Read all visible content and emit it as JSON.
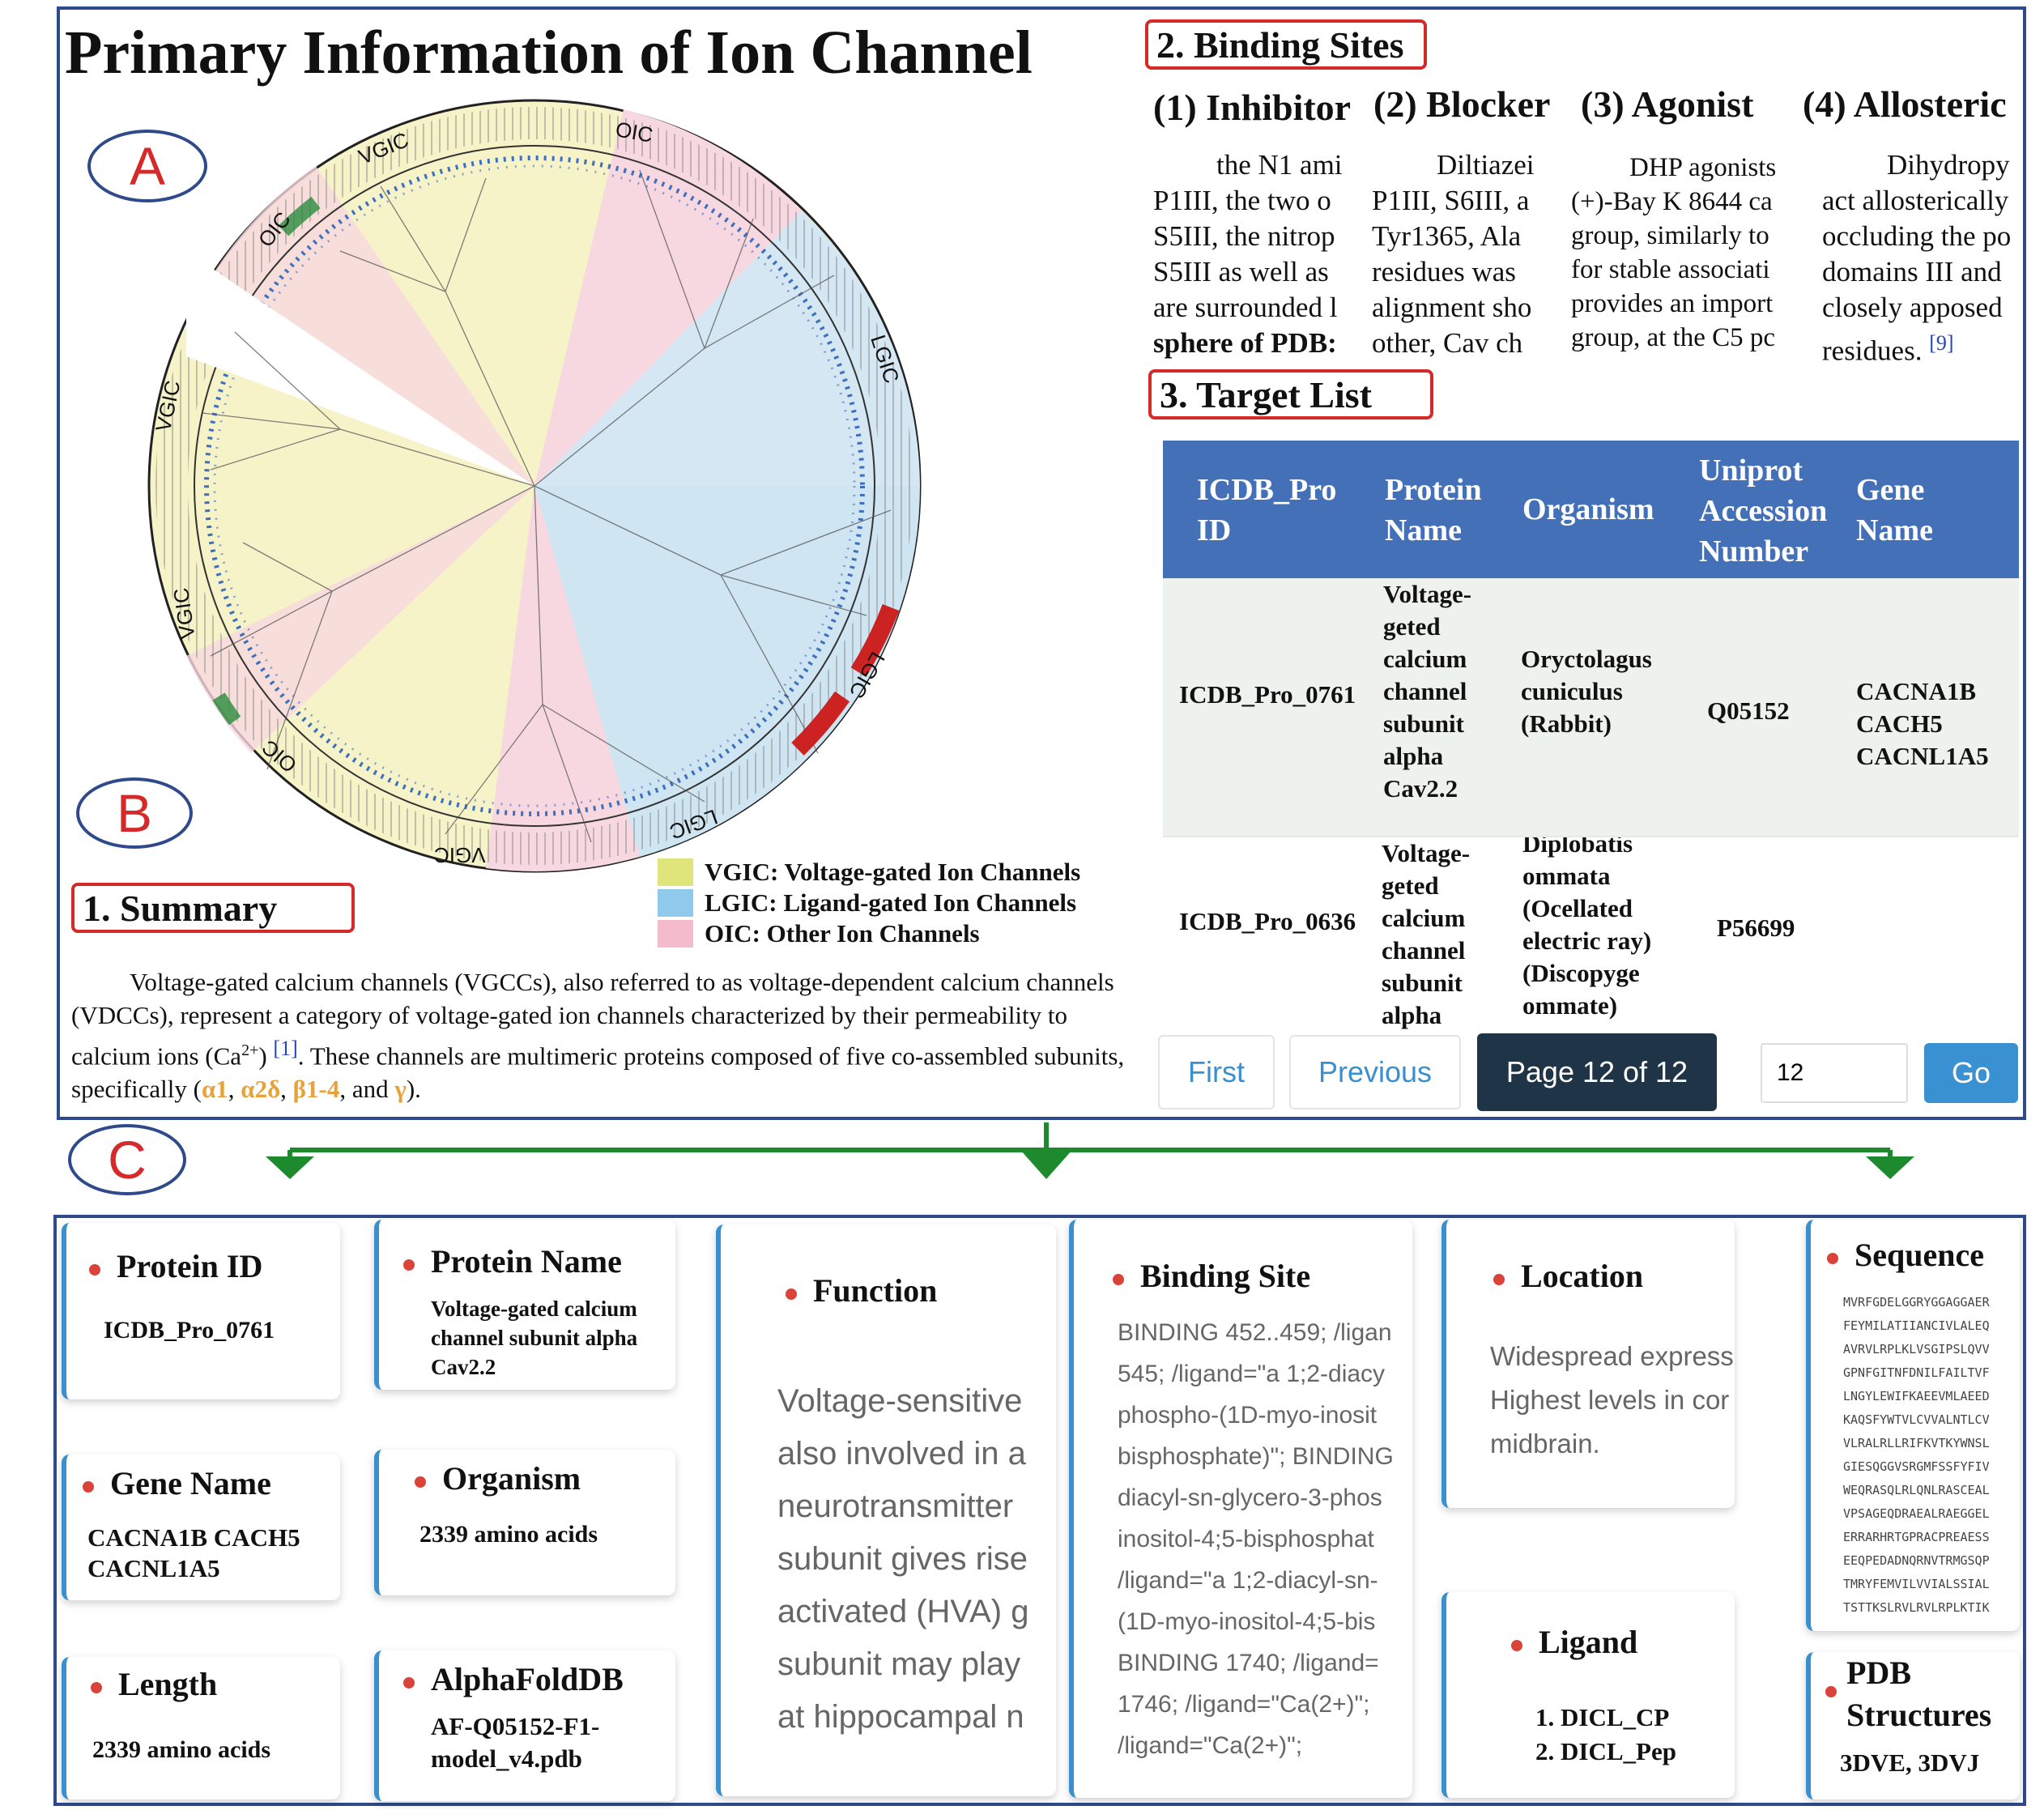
{
  "title": "Primary Information of Ion Channel",
  "labels": {
    "a": "A",
    "b": "B",
    "c": "C"
  },
  "tree": {
    "ring_labels": [
      "VGIC",
      "OIC",
      "OIC",
      "LGIC",
      "VGIC",
      "VGIC",
      "OIC",
      "LGIC",
      "LGIC",
      "VGIC"
    ],
    "colors": {
      "vgic": "#f4f0c2",
      "lgic": "#cde4f2",
      "oic": "#f8d7e0"
    }
  },
  "legend": [
    {
      "text": "VGIC: Voltage-gated Ion Channels",
      "color": "#dfe57a"
    },
    {
      "text": "LGIC: Ligand-gated Ion Channels",
      "color": "#8fc9ec"
    },
    {
      "text": "OIC: Other Ion Channels",
      "color": "#f4bccb"
    }
  ],
  "summary": {
    "heading": "1. Summary",
    "p1": "Voltage-gated calcium channels (VGCCs), also referred to as voltage-dependent calcium channels (VDCCs), represent a category of voltage-gated ion channels characterized by their permeability to calcium ions (Ca",
    "sup": "2+",
    "p2": ") ",
    "ref": "[1]",
    "p3": ". These channels are multimeric proteins composed of five co-assembled subunits, specifically (",
    "s1": "α1",
    "c1": ", ",
    "s2": "α2δ",
    "c2": ", ",
    "s3": "β1-4",
    "c3": ", and ",
    "s4": "γ",
    "c4": ")."
  },
  "binding_sites": {
    "heading": "2. Binding Sites",
    "columns": [
      {
        "title": "(1) Inhibitor",
        "lines": [
          "    the N1 ami",
          "P1III, the two o",
          "S5III, the nitrop",
          "S5III as well as",
          "are surrounded l",
          "sphere of PDB:"
        ]
      },
      {
        "title": "(2) Blocker",
        "lines": [
          "    Diltiazei",
          "P1III, S6III, a",
          "Tyr1365, Ala",
          "residues was",
          "alignment sho",
          "other, Cav ch"
        ]
      },
      {
        "title": "(3) Agonist",
        "lines": [
          "    DHP agonists",
          "(+)-Bay K 8644 ca",
          "group, similarly to",
          "for stable associati",
          "provides an import",
          "group, at the C5 pc"
        ]
      },
      {
        "title": "(4) Allosteric",
        "lines": [
          "    Dihydropy",
          "act allosterically",
          "occluding the po",
          "domains III and",
          "closely apposed",
          "residues. "
        ],
        "ref": "[9]"
      }
    ]
  },
  "target_list": {
    "heading": "3. Target List",
    "headers": [
      "ICDB_Pro ID",
      "Protein Name",
      "Organism",
      "Uniprot Accession Number",
      "Gene Name"
    ],
    "rows": [
      {
        "id": "ICDB_Pro_0761",
        "name": "Voltage-geted calcium channel subunit alpha Cav2.2",
        "organism": "Oryctolagus cuniculus (Rabbit)",
        "accession": "Q05152",
        "gene": "CACNA1B CACH5 CACNL1A5"
      },
      {
        "id": "ICDB_Pro_0636",
        "name": "Voltage-geted calcium channel subunit alpha",
        "organism": "Diplobatis ommata (Ocellated electric ray) (Discopyge ommate)",
        "accession": "P56699",
        "gene": ""
      }
    ],
    "pagination": {
      "first": "First",
      "previous": "Previous",
      "page": "Page 12 of 12",
      "input_value": "12",
      "go": "Go"
    }
  },
  "cards": {
    "protein_id": {
      "title": "Protein ID",
      "value": "ICDB_Pro_0761"
    },
    "gene_name": {
      "title": "Gene Name",
      "value": "CACNA1B CACH5 CACNL1A5"
    },
    "length": {
      "title": "Length",
      "value": "2339 amino acids"
    },
    "protein_name": {
      "title": "Protein Name",
      "value": "Voltage-gated calcium channel subunit alpha Cav2.2"
    },
    "organism": {
      "title": "Organism",
      "value": "2339 amino acids"
    },
    "alphafold": {
      "title": "AlphaFoldDB",
      "value": "AF-Q05152-F1-model_v4.pdb"
    },
    "function": {
      "title": "Function",
      "lines": [
        "Voltage-sensitive",
        "also involved in a",
        "neurotransmitter",
        "subunit gives rise",
        "activated (HVA) g",
        "subunit may play",
        "at hippocampal n"
      ]
    },
    "binding_site": {
      "title": "Binding Site",
      "lines": [
        "BINDING 452..459; /ligan",
        "545; /ligand=\"a 1;2-diacy",
        "phospho-(1D-myo-inosit",
        "bisphosphate)\"; BINDING",
        "diacyl-sn-glycero-3-phos",
        "inositol-4;5-bisphosphat",
        "/ligand=\"a 1;2-diacyl-sn-",
        "(1D-myo-inositol-4;5-bis",
        "BINDING 1740; /ligand=",
        "1746; /ligand=\"Ca(2+)\";",
        "/ligand=\"Ca(2+)\";"
      ]
    },
    "location": {
      "title": "Location",
      "lines": [
        "Widespread expressi",
        "Highest levels in cor",
        "midbrain."
      ]
    },
    "ligand": {
      "title": "Ligand",
      "items": [
        "1. DICL_CP",
        "2. DICL_Pep"
      ]
    },
    "sequence": {
      "title": "Sequence",
      "lines": [
        "MVRFGDELGGRYGGAGGAER",
        "FEYMILATIIANCIVLALEQ",
        "AVRVLRPLKLVSGIPSLQVV",
        "GPNFGITNFDNILFAILTVF",
        "LNGYLEWIFKAEEVMLAEED",
        "KAQSFYWTVLCVVALNTLCV",
        "VLRALRLLRIFKVTKYWNSL",
        "GIESQGGVSRGMFSSFYFIV",
        "WEQRASQLRLQNLRASCEAL",
        "VPSAGEQDRAEALRAEGGEL",
        "ERRARHRTGPRACPREAESS",
        "EEQPEDADNQRNVTRMGSQP",
        "TMRYFEMVILVVIALSSIAL",
        "TSTTKSLRVLRVLRPLKTIK"
      ]
    },
    "pdb": {
      "title": "PDB Structures",
      "value": "3DVE, 3DVJ"
    }
  }
}
